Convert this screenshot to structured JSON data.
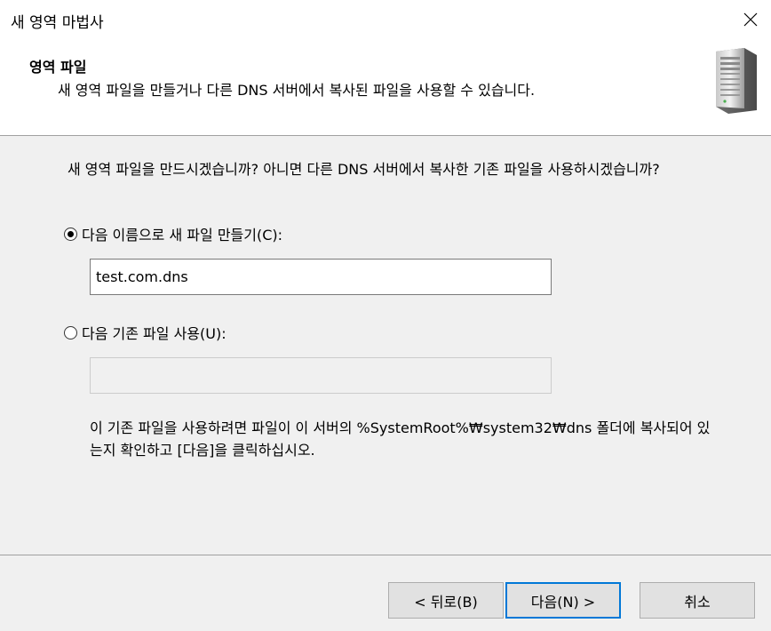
{
  "window": {
    "title": "새 영역 마법사"
  },
  "header": {
    "title": "영역 파일",
    "subtitle": "새 영역 파일을 만들거나 다른 DNS 서버에서 복사된 파일을 사용할 수 있습니다."
  },
  "content": {
    "question": "새 영역 파일을 만드시겠습니까? 아니면 다른 DNS 서버에서 복사한 기존 파일을 사용하시겠습니까?",
    "option_new": {
      "label": "다음 이름으로 새 파일 만들기(C):",
      "selected": true,
      "value": "test.com.dns"
    },
    "option_existing": {
      "label": "다음 기존 파일 사용(U):",
      "selected": false,
      "value": ""
    },
    "note": "이 기존 파일을 사용하려면 파일이 이 서버의 %SystemRoot%₩system32₩dns 폴더에 복사되어 있는지 확인하고 [다음]을 클릭하십시오."
  },
  "footer": {
    "back_label": "< 뒤로(B)",
    "next_label": "다음(N) >",
    "cancel_label": "취소"
  },
  "colors": {
    "accent": "#0078d7",
    "background": "#f0f0f0",
    "header_background": "#ffffff"
  }
}
